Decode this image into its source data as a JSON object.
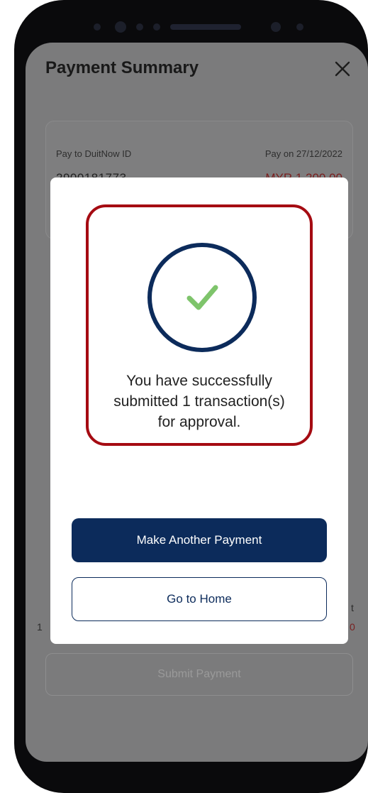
{
  "header": {
    "title": "Payment Summary",
    "close_icon": "close-icon"
  },
  "summary_card": {
    "pay_to_label": "Pay to DuitNow ID",
    "pay_on_label": "Pay on 27/12/2022",
    "duitnow_id": "2900181773",
    "amount": "MYR 1,200.00"
  },
  "behind": {
    "left_fragment": "1",
    "right_fragment_top": "t",
    "right_fragment_bottom": "0"
  },
  "modal": {
    "icon": "checkmark-icon",
    "message_line1": "You have successfully",
    "message_line2": "submitted 1 transaction(s)",
    "message_line3": "for approval.",
    "primary_label": "Make Another Payment",
    "secondary_label": "Go to Home"
  },
  "footer": {
    "submit_label": "Submit Payment"
  },
  "colors": {
    "brand_navy": "#0c2b5b",
    "check_green": "#7ec46b",
    "highlight_red": "#a50b12",
    "overlay_gray": "#7b7b7c"
  }
}
